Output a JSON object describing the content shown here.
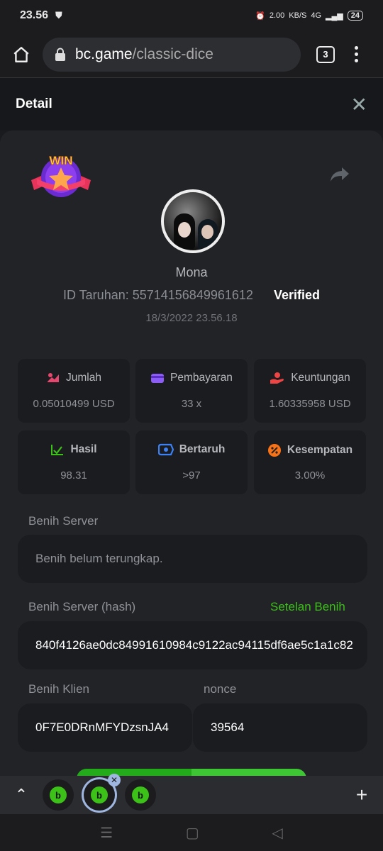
{
  "status": {
    "time": "23.56",
    "net_speed": "2.00",
    "net_unit": "KB/S",
    "network": "4G",
    "battery": "24"
  },
  "browser": {
    "host": "bc.game",
    "path": "/classic-dice",
    "tab_count": "3"
  },
  "detail": {
    "title": "Detail"
  },
  "bet": {
    "win_badge_text": "WIN",
    "username": "Mona",
    "bet_id": "ID Taruhan: 55714156849961612",
    "verified": "Verified",
    "date": "18/3/2022 23.56.18"
  },
  "stats": [
    {
      "label": "Jumlah",
      "value": "0.05010499 USD",
      "icon": "money-bag-icon",
      "color": "#e5486e"
    },
    {
      "label": "Pembayaran",
      "value": "33 x",
      "icon": "wallet-icon",
      "color": "#8b5cf6"
    },
    {
      "label": "Keuntungan",
      "value": "1.60335958 USD",
      "icon": "profit-hand-icon",
      "color": "#ef4444"
    },
    {
      "label": "Hasil",
      "value": "98.31",
      "icon": "chart-check-icon",
      "color": "#3bc117"
    },
    {
      "label": "Bertaruh",
      "value": ">97",
      "icon": "ticket-icon",
      "color": "#3b82f6"
    },
    {
      "label": "Kesempatan",
      "value": "3.00%",
      "icon": "percent-icon",
      "color": "#f97316"
    }
  ],
  "seeds": {
    "server_label": "Benih Server",
    "server_value": "Benih belum terungkap.",
    "hash_label": "Benih Server (hash)",
    "reset_link": "Setelan Benih",
    "hash_value": "840f4126ae0dc84991610984c9122ac94115df6ae5c1a1c82",
    "client_label": "Benih Klien",
    "client_value": "0F7E0DRnMFYDzsnJA4",
    "nonce_label": "nonce",
    "nonce_value": "39564"
  },
  "tabstrip": {
    "tab_letter": "b"
  }
}
